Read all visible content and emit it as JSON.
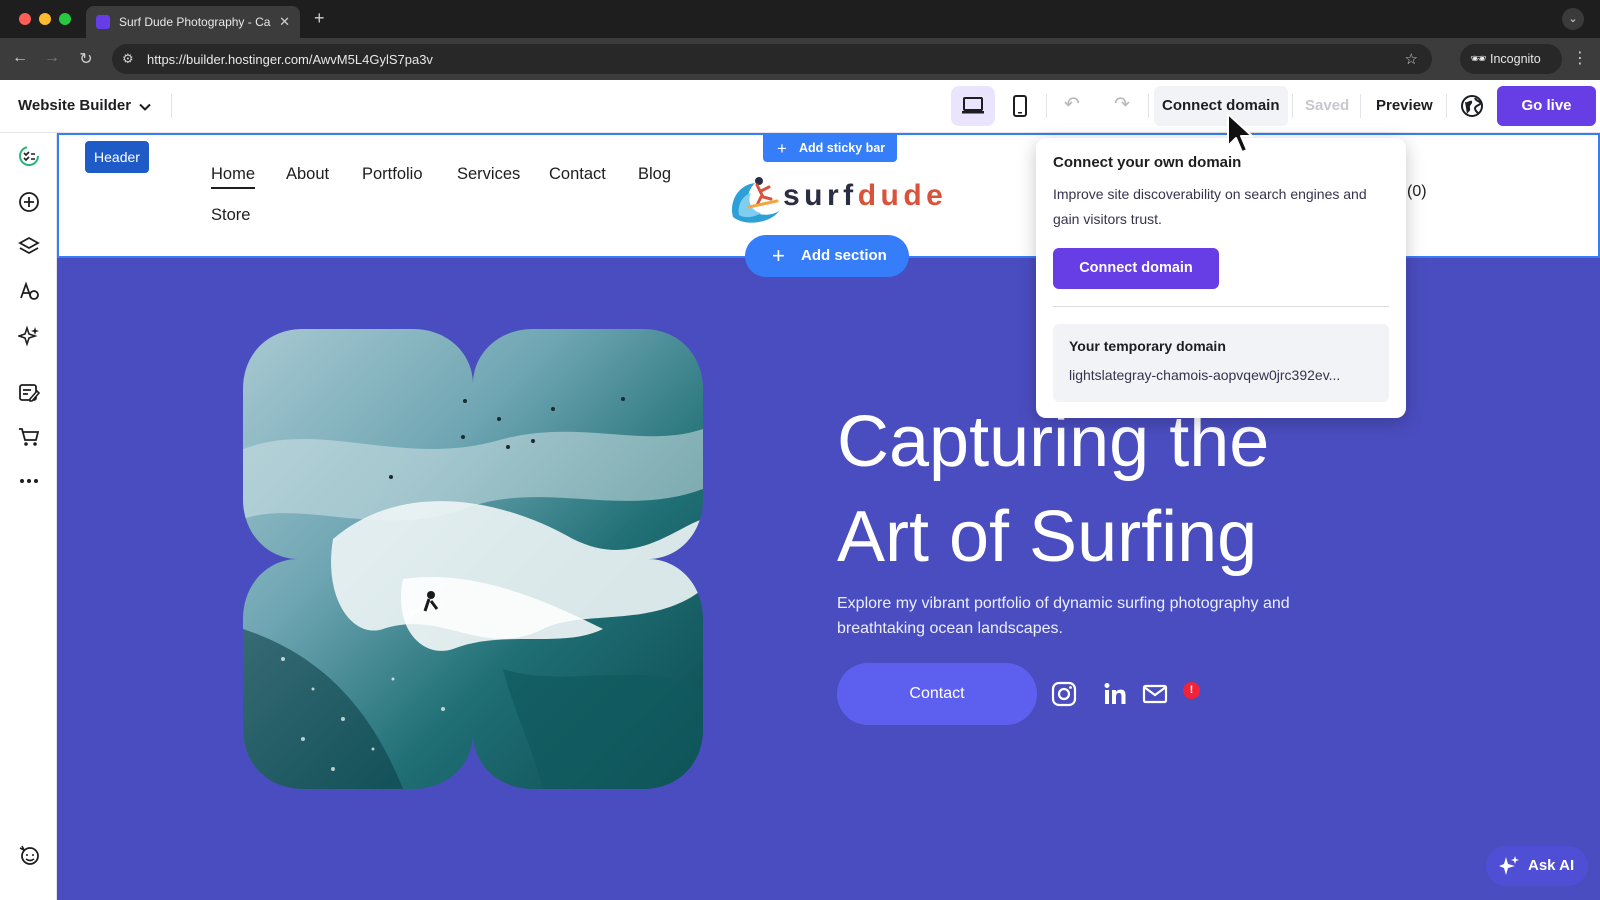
{
  "browser": {
    "tab_title": "Surf Dude Photography - Cap",
    "url": "https://builder.hostinger.com/AwvM5L4GylS7pa3v",
    "incognito_label": "Incognito"
  },
  "toolbar": {
    "app_title": "Website Builder",
    "connect_domain": "Connect domain",
    "saved": "Saved",
    "preview": "Preview",
    "go_live": "Go live"
  },
  "canvas": {
    "header_badge": "Header",
    "sticky_bar": "Add sticky bar",
    "add_section": "Add section"
  },
  "site": {
    "nav": [
      "Home",
      "About",
      "Portfolio",
      "Services",
      "Contact",
      "Blog",
      "Store"
    ],
    "logo_part1": "surf",
    "logo_part2": "dude",
    "cart": "(0)",
    "hero_title_line1": "Capturing the",
    "hero_title_line2": "Art of Surfing",
    "hero_sub": "Explore my vibrant portfolio of dynamic surfing photography and breathtaking ocean landscapes.",
    "contact_button": "Contact",
    "mail_badge": "!"
  },
  "popover": {
    "title": "Connect your own domain",
    "description": "Improve site discoverability on search engines and gain visitors trust.",
    "button": "Connect domain",
    "temp_title": "Your temporary domain",
    "temp_value": "lightslategray-chamois-aopvqew0jrc392ev..."
  },
  "ask_ai": "Ask AI",
  "colors": {
    "brand": "#673de6",
    "canvas_bg": "#4a4dbf",
    "editor_accent": "#357df9"
  }
}
